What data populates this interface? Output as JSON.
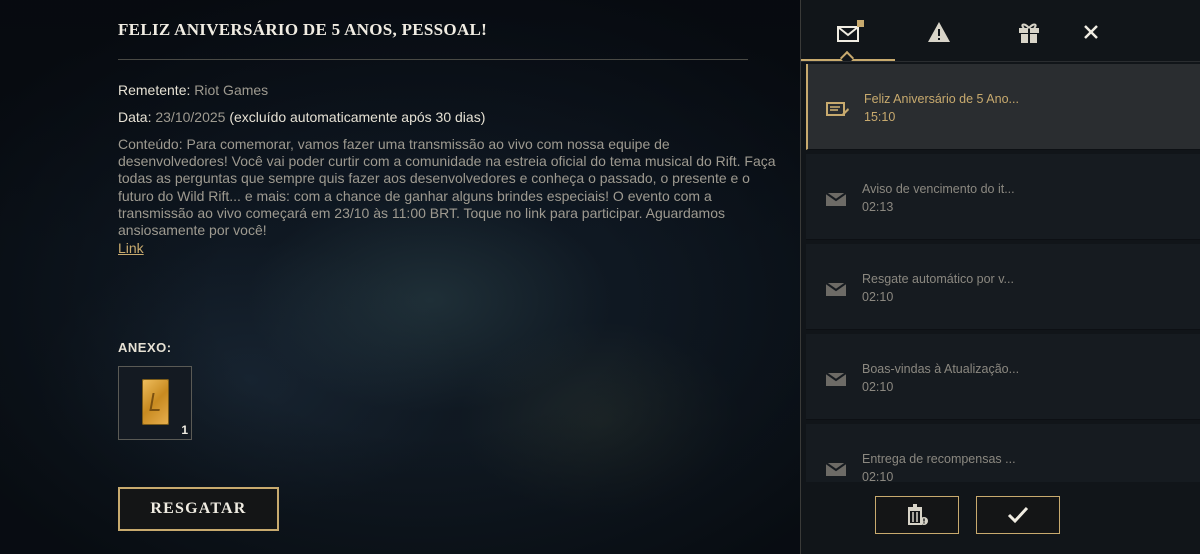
{
  "mail": {
    "title": "FELIZ ANIVERSÁRIO DE 5 ANOS, PESSOAL!",
    "sender_label": "Remetente:",
    "sender_value": "Riot Games",
    "date_label": "Data:",
    "date_value": "23/10/2025",
    "date_note": "(excluído automaticamente após 30 dias)",
    "content_label": "Conteúdo:",
    "content_text": "Para comemorar, vamos fazer uma transmissão ao vivo com nossa equipe de desenvolvedores! Você vai poder curtir com a comunidade na estreia oficial do tema musical do Rift. Faça todas as perguntas que sempre quis fazer aos desenvolvedores e conheça o passado, o presente e o futuro do Wild Rift... e mais: com a chance de ganhar alguns brindes especiais! O evento com a transmissão ao vivo começará em 23/10 às 11:00 BRT. Toque no link para participar. Aguardamos ansiosamente por você!",
    "link_label": "Link",
    "attachment_label": "ANEXO:",
    "attachment_qty": "1",
    "redeem_label": "RESGATAR"
  },
  "tabs": [
    {
      "icon": "mail-icon",
      "active": true,
      "badge": "gift-badge"
    },
    {
      "icon": "warning-icon",
      "active": false
    },
    {
      "icon": "gift-icon",
      "active": false
    },
    {
      "icon": "close-icon",
      "active": false
    }
  ],
  "mail_list": [
    {
      "subject": "Feliz Aniversário de 5 Ano...",
      "time": "15:10",
      "icon": "mail-read-icon",
      "active": true
    },
    {
      "subject": "Aviso de vencimento do it...",
      "time": "02:13",
      "icon": "mail-icon",
      "active": false
    },
    {
      "subject": "Resgate automático por v...",
      "time": "02:10",
      "icon": "mail-icon",
      "active": false
    },
    {
      "subject": "Boas-vindas à Atualização...",
      "time": "02:10",
      "icon": "mail-icon",
      "active": false
    },
    {
      "subject": "Entrega de recompensas ...",
      "time": "02:10",
      "icon": "mail-icon",
      "active": false
    }
  ],
  "colors": {
    "accent": "#c8aa6e",
    "text_primary": "#f0ece2",
    "text_secondary": "#9e9a90"
  }
}
